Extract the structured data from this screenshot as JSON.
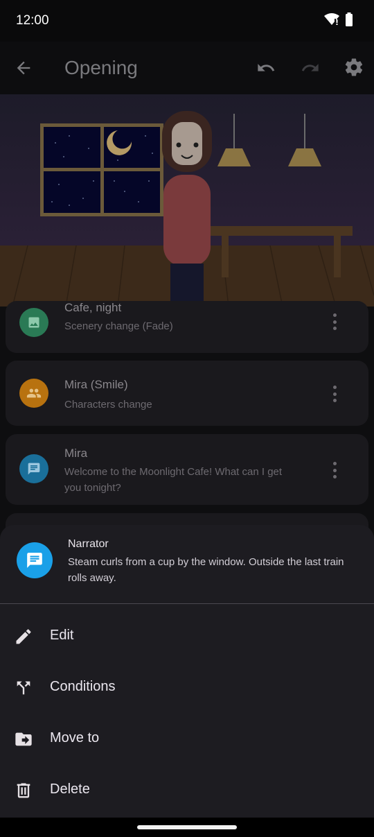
{
  "status": {
    "time": "12:00"
  },
  "app_bar": {
    "title": "Opening"
  },
  "items": [
    {
      "title": "Cafe, night",
      "subtitle": "Scenery change (Fade)",
      "icon": "image-icon",
      "color": "#2a7a55"
    },
    {
      "title": "Mira (Smile)",
      "subtitle": "Characters change",
      "icon": "people-icon",
      "color": "#b8720f"
    },
    {
      "title": "Mira",
      "subtitle": "Welcome to the Moonlight Cafe! What can I get you tonight?",
      "icon": "chat-bubble-icon",
      "color": "#1a6f9a"
    }
  ],
  "sheet": {
    "speaker": "Narrator",
    "text": "Steam curls from a cup by the window. Outside the last train rolls away.",
    "avatar_color": "#1aa0e8",
    "actions": [
      {
        "label": "Edit",
        "icon": "pencil-icon"
      },
      {
        "label": "Conditions",
        "icon": "branch-icon"
      },
      {
        "label": "Move to",
        "icon": "folder-move-icon"
      },
      {
        "label": "Delete",
        "icon": "trash-icon"
      }
    ]
  }
}
